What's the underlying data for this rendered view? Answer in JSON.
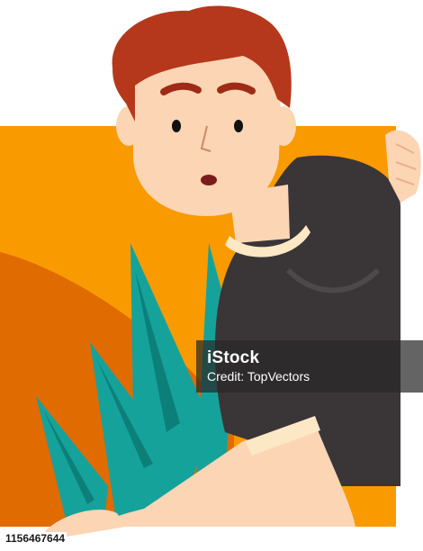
{
  "watermark": {
    "brand": "iStock",
    "credit": "Credit: TopVectors"
  },
  "stock_id": "1156467644",
  "colors": {
    "background_orange": "#f99a00",
    "dark_orange": "#e06b00",
    "hair": "#b5381d",
    "skin": "#fcd5b4",
    "shirt": "#3a3537",
    "collar": "#fce8c5",
    "grass": "#15a29b"
  }
}
